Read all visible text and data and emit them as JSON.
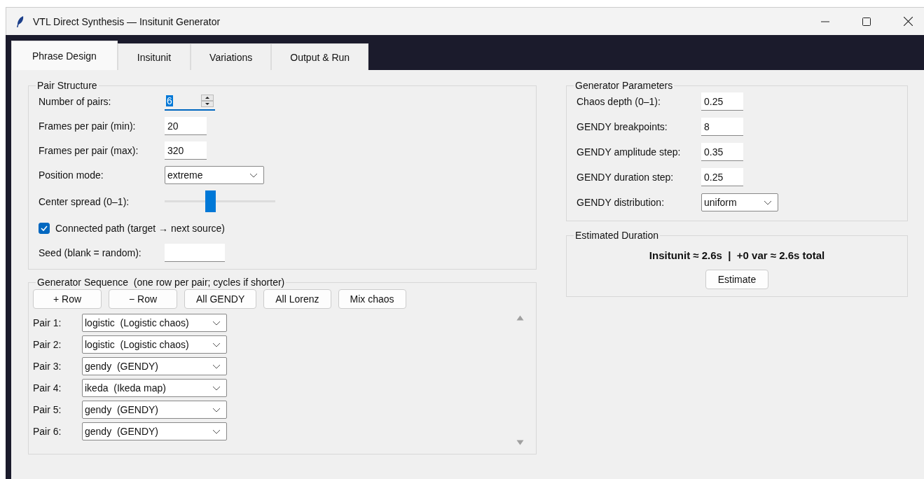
{
  "window": {
    "title": "VTL Direct Synthesis — Insitunit Generator"
  },
  "tabs": [
    {
      "label": "Phrase Design",
      "selected": true
    },
    {
      "label": "Insitunit",
      "selected": false
    },
    {
      "label": "Variations",
      "selected": false
    },
    {
      "label": "Output & Run",
      "selected": false
    }
  ],
  "pair_structure": {
    "title": "Pair Structure",
    "fields": [
      {
        "kind": "spin",
        "label": "Number of pairs:",
        "value": "6",
        "focused": true
      },
      {
        "kind": "entry",
        "label": "Frames per pair (min):",
        "value": "20"
      },
      {
        "kind": "entry",
        "label": "Frames per pair (max):",
        "value": "320"
      },
      {
        "kind": "select",
        "label": "Position mode:",
        "value": "extreme"
      },
      {
        "kind": "slider",
        "label": "Center spread (0–1):",
        "level": 0.41
      },
      {
        "kind": "checkbox",
        "label": "Connected path (target → next source)",
        "checked": true
      },
      {
        "kind": "entry",
        "label": "Seed (blank = random):"
      }
    ]
  },
  "generator_sequence": {
    "title": "Generator Sequence  (one row per pair; cycles if shorter)",
    "buttons": [
      "+ Row",
      "− Row",
      "All GENDY",
      "All Lorenz",
      "Mix chaos"
    ],
    "rows": [
      {
        "label": "Pair 1:",
        "value": "logistic  (Logistic chaos)"
      },
      {
        "label": "Pair 2:",
        "value": "logistic  (Logistic chaos)"
      },
      {
        "label": "Pair 3:",
        "value": "gendy  (GENDY)"
      },
      {
        "label": "Pair 4:",
        "value": "ikeda  (Ikeda map)"
      },
      {
        "label": "Pair 5:",
        "value": "gendy  (GENDY)"
      },
      {
        "label": "Pair 6:",
        "value": "gendy  (GENDY)"
      }
    ]
  },
  "generator_parameters": {
    "title": "Generator Parameters",
    "fields": [
      {
        "kind": "entry",
        "label": "Chaos depth (0–1):",
        "value": "0.25"
      },
      {
        "kind": "entry",
        "label": "GENDY breakpoints:",
        "value": "8"
      },
      {
        "kind": "entry",
        "label": "GENDY amplitude step:",
        "value": "0.35"
      },
      {
        "kind": "entry",
        "label": "GENDY duration step:",
        "value": "0.25"
      },
      {
        "kind": "select",
        "label": "GENDY distribution:",
        "value": "uniform"
      }
    ]
  },
  "estimated_duration": {
    "title": "Estimated Duration",
    "summary": "Insitunit ≈ 2.6s  |  +0 var ≈ 2.6s total",
    "button": "Estimate"
  }
}
